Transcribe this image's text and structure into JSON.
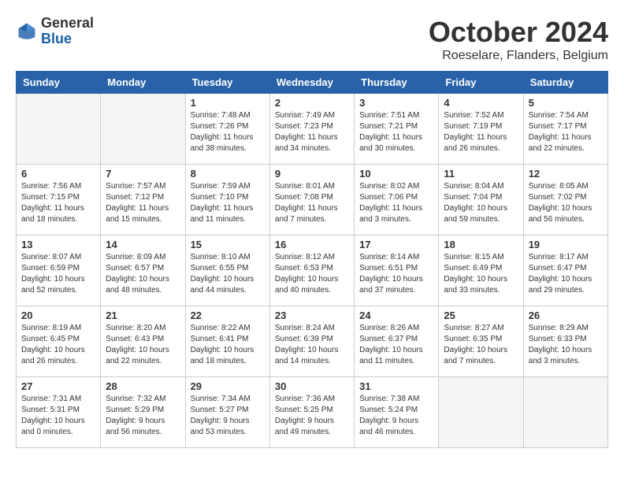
{
  "header": {
    "logo_general": "General",
    "logo_blue": "Blue",
    "month": "October 2024",
    "location": "Roeselare, Flanders, Belgium"
  },
  "days_of_week": [
    "Sunday",
    "Monday",
    "Tuesday",
    "Wednesday",
    "Thursday",
    "Friday",
    "Saturday"
  ],
  "weeks": [
    [
      {
        "num": "",
        "info": ""
      },
      {
        "num": "",
        "info": ""
      },
      {
        "num": "1",
        "info": "Sunrise: 7:48 AM\nSunset: 7:26 PM\nDaylight: 11 hours\nand 38 minutes."
      },
      {
        "num": "2",
        "info": "Sunrise: 7:49 AM\nSunset: 7:23 PM\nDaylight: 11 hours\nand 34 minutes."
      },
      {
        "num": "3",
        "info": "Sunrise: 7:51 AM\nSunset: 7:21 PM\nDaylight: 11 hours\nand 30 minutes."
      },
      {
        "num": "4",
        "info": "Sunrise: 7:52 AM\nSunset: 7:19 PM\nDaylight: 11 hours\nand 26 minutes."
      },
      {
        "num": "5",
        "info": "Sunrise: 7:54 AM\nSunset: 7:17 PM\nDaylight: 11 hours\nand 22 minutes."
      }
    ],
    [
      {
        "num": "6",
        "info": "Sunrise: 7:56 AM\nSunset: 7:15 PM\nDaylight: 11 hours\nand 18 minutes."
      },
      {
        "num": "7",
        "info": "Sunrise: 7:57 AM\nSunset: 7:12 PM\nDaylight: 11 hours\nand 15 minutes."
      },
      {
        "num": "8",
        "info": "Sunrise: 7:59 AM\nSunset: 7:10 PM\nDaylight: 11 hours\nand 11 minutes."
      },
      {
        "num": "9",
        "info": "Sunrise: 8:01 AM\nSunset: 7:08 PM\nDaylight: 11 hours\nand 7 minutes."
      },
      {
        "num": "10",
        "info": "Sunrise: 8:02 AM\nSunset: 7:06 PM\nDaylight: 11 hours\nand 3 minutes."
      },
      {
        "num": "11",
        "info": "Sunrise: 8:04 AM\nSunset: 7:04 PM\nDaylight: 10 hours\nand 59 minutes."
      },
      {
        "num": "12",
        "info": "Sunrise: 8:05 AM\nSunset: 7:02 PM\nDaylight: 10 hours\nand 56 minutes."
      }
    ],
    [
      {
        "num": "13",
        "info": "Sunrise: 8:07 AM\nSunset: 6:59 PM\nDaylight: 10 hours\nand 52 minutes."
      },
      {
        "num": "14",
        "info": "Sunrise: 8:09 AM\nSunset: 6:57 PM\nDaylight: 10 hours\nand 48 minutes."
      },
      {
        "num": "15",
        "info": "Sunrise: 8:10 AM\nSunset: 6:55 PM\nDaylight: 10 hours\nand 44 minutes."
      },
      {
        "num": "16",
        "info": "Sunrise: 8:12 AM\nSunset: 6:53 PM\nDaylight: 10 hours\nand 40 minutes."
      },
      {
        "num": "17",
        "info": "Sunrise: 8:14 AM\nSunset: 6:51 PM\nDaylight: 10 hours\nand 37 minutes."
      },
      {
        "num": "18",
        "info": "Sunrise: 8:15 AM\nSunset: 6:49 PM\nDaylight: 10 hours\nand 33 minutes."
      },
      {
        "num": "19",
        "info": "Sunrise: 8:17 AM\nSunset: 6:47 PM\nDaylight: 10 hours\nand 29 minutes."
      }
    ],
    [
      {
        "num": "20",
        "info": "Sunrise: 8:19 AM\nSunset: 6:45 PM\nDaylight: 10 hours\nand 26 minutes."
      },
      {
        "num": "21",
        "info": "Sunrise: 8:20 AM\nSunset: 6:43 PM\nDaylight: 10 hours\nand 22 minutes."
      },
      {
        "num": "22",
        "info": "Sunrise: 8:22 AM\nSunset: 6:41 PM\nDaylight: 10 hours\nand 18 minutes."
      },
      {
        "num": "23",
        "info": "Sunrise: 8:24 AM\nSunset: 6:39 PM\nDaylight: 10 hours\nand 14 minutes."
      },
      {
        "num": "24",
        "info": "Sunrise: 8:26 AM\nSunset: 6:37 PM\nDaylight: 10 hours\nand 11 minutes."
      },
      {
        "num": "25",
        "info": "Sunrise: 8:27 AM\nSunset: 6:35 PM\nDaylight: 10 hours\nand 7 minutes."
      },
      {
        "num": "26",
        "info": "Sunrise: 8:29 AM\nSunset: 6:33 PM\nDaylight: 10 hours\nand 3 minutes."
      }
    ],
    [
      {
        "num": "27",
        "info": "Sunrise: 7:31 AM\nSunset: 5:31 PM\nDaylight: 10 hours\nand 0 minutes."
      },
      {
        "num": "28",
        "info": "Sunrise: 7:32 AM\nSunset: 5:29 PM\nDaylight: 9 hours\nand 56 minutes."
      },
      {
        "num": "29",
        "info": "Sunrise: 7:34 AM\nSunset: 5:27 PM\nDaylight: 9 hours\nand 53 minutes."
      },
      {
        "num": "30",
        "info": "Sunrise: 7:36 AM\nSunset: 5:25 PM\nDaylight: 9 hours\nand 49 minutes."
      },
      {
        "num": "31",
        "info": "Sunrise: 7:38 AM\nSunset: 5:24 PM\nDaylight: 9 hours\nand 46 minutes."
      },
      {
        "num": "",
        "info": ""
      },
      {
        "num": "",
        "info": ""
      }
    ]
  ]
}
